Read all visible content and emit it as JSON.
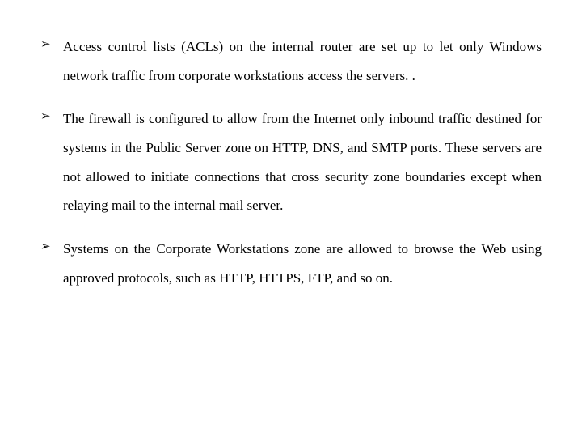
{
  "bullets": [
    {
      "text": "Access control lists (ACLs) on the internal router are set up to let only Windows network traffic from corporate workstations access the servers. ."
    },
    {
      "text": "The firewall is configured to allow from the Internet only inbound traffic destined for systems in the Public Server zone on HTTP, DNS, and SMTP ports. These servers are not allowed to initiate connections that cross security zone boundaries except when relaying mail to the internal mail server."
    },
    {
      "text": "Systems on the Corporate Workstations zone are allowed to browse the Web using approved protocols, such as HTTP, HTTPS, FTP, and so on."
    }
  ]
}
